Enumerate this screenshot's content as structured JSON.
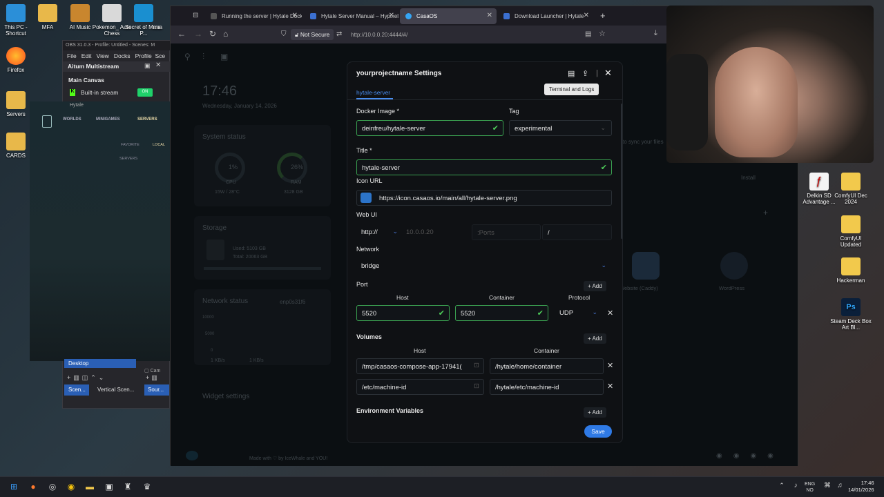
{
  "desktop": {
    "left_icons": [
      {
        "label": "This PC - Shortcut"
      },
      {
        "label": "Firefox"
      },
      {
        "label": "Servers"
      },
      {
        "label": "CARDS"
      }
    ],
    "top_icons": [
      {
        "label": "MFA"
      },
      {
        "label": "AI Music"
      },
      {
        "label": "Pokemon_ Auto Chess"
      },
      {
        "label": "Secret of Mana P..."
      },
      {
        "label": "ma"
      }
    ],
    "right_icons": [
      {
        "label": "Delkin SD Advantage ..."
      },
      {
        "label": "ComfyUI Dec 2024"
      },
      {
        "label": "ComfyUI Updated"
      },
      {
        "label": "Hackerman"
      },
      {
        "label": "Steam Deck Box Art Bl..."
      }
    ]
  },
  "obs": {
    "title": "OBS 31.0.3 - Profile: Untitled - Scenes: M",
    "menu": [
      "File",
      "Edit",
      "View",
      "Docks",
      "Profile",
      "Sce"
    ],
    "dock_title": "Aitum Multistream",
    "canvas_label": "Main Canvas",
    "stream_label": "Built-in stream",
    "stream_badge": "ON",
    "hytale_title": "Hytale",
    "hytale_nav": [
      "WORLDS",
      "MINIGAMES",
      "SERVERS"
    ],
    "hytale_sub": [
      "FAVORITE",
      "LOCAL"
    ],
    "hytale_servers": "SERVERS",
    "scene_item": "Desktop",
    "bottom_tabs": [
      "Scen...",
      "Vertical Scen...",
      "Sour..."
    ],
    "cam_label": "Cam"
  },
  "browser": {
    "tabs": [
      {
        "label": "Running the server | Hytale Docker"
      },
      {
        "label": "Hytale Server Manual – Hypixel"
      },
      {
        "label": "CasaOS"
      },
      {
        "label": "Download Launcher | Hytale"
      }
    ],
    "security": "Not Secure",
    "url": "http://10.0.0.20:4444/#/"
  },
  "casaos_bg": {
    "time": "17:46",
    "date": "Wednesday, January 14, 2026",
    "system_status": "System status",
    "cpu_value": "1%",
    "cpu_label": "CPU",
    "cpu_sub": "15W / 28°C",
    "ram_value": "26%",
    "ram_label": "RAM",
    "ram_sub": "3128 GB",
    "storage": "Storage",
    "storage_used": "Used: 5103 GB",
    "storage_total": "Total: 20063 GB",
    "network_status": "Network status",
    "network_iface": "enp0s31f6",
    "net_ticks": [
      "10000",
      "5000",
      "0"
    ],
    "net_speeds": [
      "1 KB/s",
      "1 KB/s"
    ],
    "widget_settings": "Widget settings",
    "sync_text": "to sync your files",
    "install": "Install",
    "apps": [
      {
        "label": "Website (Caddy)"
      },
      {
        "label": "WordPress"
      }
    ],
    "footer": "Made with ♡ by IceWhale and YOU!"
  },
  "dialog": {
    "title": "yourprojectname Settings",
    "tab": "hytale-server",
    "tooltip": "Terminal and Logs",
    "docker_image_label": "Docker Image *",
    "docker_image": "deinfreu/hytale-server",
    "tag_label": "Tag",
    "tag": "experimental",
    "title_label": "Title *",
    "title_value": "hytale-server",
    "icon_label": "Icon URL",
    "icon_url": "https://icon.casaos.io/main/all/hytale-server.png",
    "webui_label": "Web UI",
    "webui_scheme": "http://",
    "webui_host": "10.0.0.20",
    "webui_ports": "Ports",
    "webui_path": "/",
    "network_label": "Network",
    "network": "bridge",
    "port_label": "Port",
    "add": "+ Add",
    "host_col": "Host",
    "container_col": "Container",
    "protocol_col": "Protocol",
    "port_host": "5520",
    "port_container": "5520",
    "protocol": "UDP",
    "volumes_label": "Volumes",
    "vol_host_col": "Host",
    "vol_container_col": "Container",
    "volumes": [
      {
        "host": "/tmp/casaos-compose-app-17941(",
        "container": "/hytale/home/container"
      },
      {
        "host": "/etc/machine-id",
        "container": "/hytale/etc/machine-id"
      }
    ],
    "env_label": "Environment Variables",
    "save": "Save"
  },
  "taskbar": {
    "lang1": "ENG",
    "lang2": "NO",
    "time": "17:46",
    "date": "14/01/2026"
  }
}
